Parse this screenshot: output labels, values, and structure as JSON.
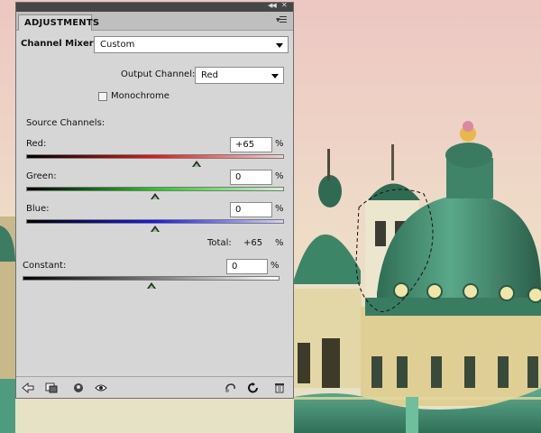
{
  "panel": {
    "tab_label": "ADJUSTMENTS",
    "preset_label": "Channel Mixer",
    "preset_value": "Custom",
    "output_channel_label": "Output Channel:",
    "output_channel_value": "Red",
    "monochrome_label": "Monochrome",
    "monochrome_checked": false,
    "source_channels_label": "Source Channels:",
    "channels": [
      {
        "label": "Red:",
        "value": "+65",
        "unit": "%",
        "percent": 65,
        "gradient_color": "#e11a1a"
      },
      {
        "label": "Green:",
        "value": "0",
        "unit": "%",
        "percent": 0,
        "gradient_color": "#22cc22"
      },
      {
        "label": "Blue:",
        "value": "0",
        "unit": "%",
        "percent": 0,
        "gradient_color": "#1a1aee"
      }
    ],
    "total_label": "Total:",
    "total_value": "+65",
    "total_unit": "%",
    "constant": {
      "label": "Constant:",
      "value": "0",
      "unit": "%",
      "percent": 0
    },
    "bottom_icons": [
      "back-arrow-icon",
      "clip-layer-icon",
      "visibility-state-icon",
      "eye-icon",
      "reset-previous-icon",
      "reset-icon",
      "trash-icon"
    ]
  },
  "colors": {
    "panel_bg": "#d6d6d6",
    "titlebar": "#464646",
    "sky": "#ecd8cc",
    "dome_green": "#3f8a6e"
  }
}
